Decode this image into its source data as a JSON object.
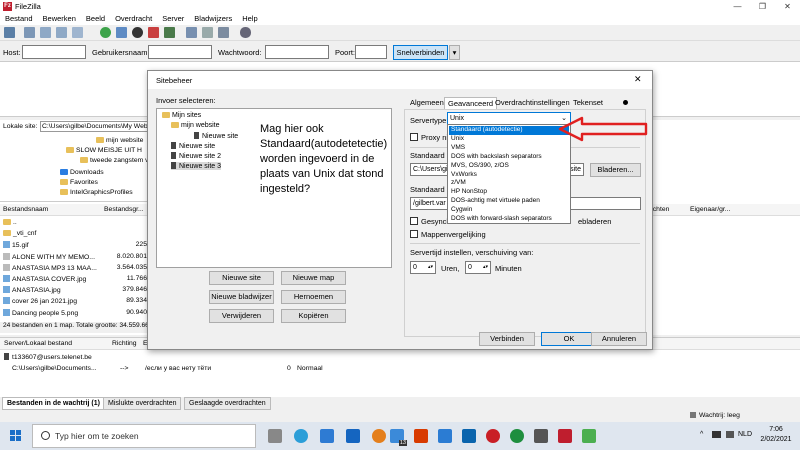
{
  "app": {
    "title": "FileZilla",
    "icon_letter": "Fz",
    "window_controls": [
      "—",
      "❐",
      "✕"
    ]
  },
  "menu": [
    "Bestand",
    "Bewerken",
    "Beeld",
    "Overdracht",
    "Server",
    "Bladwijzers",
    "Help"
  ],
  "quickconnect": {
    "host_label": "Host:",
    "user_label": "Gebruikersnaam:",
    "password_label": "Wachtwoord:",
    "port_label": "Poort:",
    "connect_button": "Snelverbinden",
    "dropdown_arrow": "▾"
  },
  "local": {
    "site_label": "Lokale site:",
    "site_path": "C:\\Users\\gilbe\\Documents\\My Web",
    "tree": [
      {
        "name": "mijn website",
        "indent": 0
      },
      {
        "name": "SLOW MEISJE UIT H",
        "indent": 1
      },
      {
        "name": "tweede zangstem v",
        "indent": 1
      },
      {
        "name": "Downloads",
        "indent": 0
      },
      {
        "name": "Favorites",
        "indent": 0
      },
      {
        "name": "IntelGraphicsProfiles",
        "indent": 0
      }
    ],
    "columns": [
      "Bestandsnaam",
      "Bestandsgr..."
    ],
    "files": [
      {
        "name": "..",
        "size": "",
        "type": "folder"
      },
      {
        "name": "_vti_cnf",
        "size": "",
        "type": "folder"
      },
      {
        "name": "15.gif",
        "size": "225",
        "type": "img"
      },
      {
        "name": "ALONE WITH MY MEMO...",
        "size": "8.020.801",
        "type": "music"
      },
      {
        "name": "ANASTASIA  MP3 13 MAA...",
        "size": "3.564.035",
        "type": "music"
      },
      {
        "name": "ANASTASIA COVER.jpg",
        "size": "11.766",
        "type": "img"
      },
      {
        "name": "ANASTASIA.jpg",
        "size": "379.846",
        "type": "img"
      },
      {
        "name": "cover 26 jan 2021.jpg",
        "size": "89.334",
        "type": "img"
      },
      {
        "name": "Dancing people 5.png",
        "size": "90.940",
        "type": "img"
      }
    ],
    "summary": "24 bestanden en 1 map. Totale grootte: 34.559.66"
  },
  "remote": {
    "columns": [
      "echten",
      "Eigenaar/gr..."
    ]
  },
  "queue": {
    "columns": [
      "Server/Lokaal bestand",
      "Richting",
      "Ex"
    ],
    "rows": [
      {
        "server": "t133607@users.telenet.be",
        "direction": "",
        "remote": "",
        "size": "",
        "priority": ""
      },
      {
        "server": "C:\\Users\\gilbe\\Documents...",
        "direction": "-->",
        "remote": "/если у вас нету тёти",
        "size": "0",
        "priority": "Normaal"
      }
    ],
    "tabs": [
      "Bestanden in de wachtrij (1)",
      "Mislukte overdrachten",
      "Geslaagde overdrachten"
    ],
    "status": "Wachtrij: leeg"
  },
  "dialog": {
    "title": "Sitebeheer",
    "close": "✕",
    "select_label": "Invoer selecteren:",
    "tree": [
      {
        "name": "Mijn sites",
        "kind": "folder",
        "indent": 0
      },
      {
        "name": "mijn website",
        "kind": "folder",
        "indent": 1
      },
      {
        "name": "Nieuwe site",
        "kind": "server",
        "indent": 2
      },
      {
        "name": "Nieuwe site",
        "kind": "server",
        "indent": 1
      },
      {
        "name": "Nieuwe site 2",
        "kind": "server",
        "indent": 1
      },
      {
        "name": "Nieuwe site 3",
        "kind": "server",
        "indent": 1
      }
    ],
    "annotation": "Mag hier ook Standaard(autodetetectie) worden ingevoerd in de plaats van Unix dat stond ingesteld?",
    "buttons": {
      "new_site": "Nieuwe site",
      "new_folder": "Nieuwe map",
      "new_bookmark": "Nieuwe bladwijzer",
      "rename": "Hernoemen",
      "delete": "Verwijderen",
      "copy": "Kopiëren",
      "connect": "Verbinden",
      "ok": "OK",
      "cancel": "Annuleren",
      "browse": "Bladeren..."
    },
    "tabs": [
      "Algemeen",
      "Geavanceerd",
      "Overdrachtinstellingen",
      "Tekenset"
    ],
    "active_tab": "Geavanceerd",
    "servertype_label": "Servertype:",
    "servertype_value": "Unix",
    "proxy_label": "Proxy nie",
    "local_dir_label": "Standaard lo",
    "local_dir_value": "C:\\Users\\gi",
    "local_dir_suffix": "osite",
    "remote_dir_label": "Standaard e",
    "remote_dir_value": "/gilbert.var",
    "sync_label": "Gesynchr",
    "sync_suffix": "ebladeren",
    "compare_label": "Mappenvergelijking",
    "timeoffset_label": "Servertijd instellen, verschuiving van:",
    "hours_value": "0",
    "hours_label": "Uren,",
    "minutes_value": "0",
    "minutes_label": "Minuten",
    "dropdown_options": [
      "Standaard (autodetectie)",
      "Unix",
      "VMS",
      "DOS with backslash separators",
      "MVS, OS/390, z/OS",
      "VxWorks",
      "z/VM",
      "HP NonStop",
      "DOS-achtig met virtuele paden",
      "Cygwin",
      "DOS with forward-slash separators"
    ],
    "dropdown_selected": 0,
    "arrow_color": "#e02020"
  },
  "taskbar": {
    "search_placeholder": "Typ hier om te zoeken",
    "time": "7:06",
    "date": "2/02/2021",
    "lang": "NLD",
    "weather_badge": "13"
  }
}
